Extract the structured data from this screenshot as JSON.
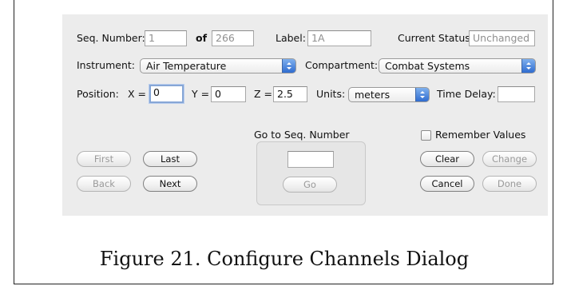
{
  "row1": {
    "seq_label": "Seq. Number:",
    "seq_value": "1",
    "of_label": "of",
    "total_value": "266",
    "label_label": "Label:",
    "label_value": "1A",
    "status_label": "Current Status:",
    "status_value": "Unchanged"
  },
  "row2": {
    "instrument_label": "Instrument:",
    "instrument_value": "Air Temperature",
    "compartment_label": "Compartment:",
    "compartment_value": "Combat Systems"
  },
  "row3": {
    "position_label": "Position:",
    "x_label": "X =",
    "x_value": "0",
    "y_label": "Y =",
    "y_value": "0",
    "z_label": "Z =",
    "z_value": "2.5",
    "units_label": "Units:",
    "units_value": "meters",
    "delay_label": "Time Delay:",
    "delay_value": ""
  },
  "goto": {
    "title": "Go to Seq. Number",
    "value": "",
    "go_label": "Go"
  },
  "remember": {
    "label": "Remember Values",
    "checked": false
  },
  "nav_buttons": {
    "first": "First",
    "last": "Last",
    "back": "Back",
    "next": "Next"
  },
  "action_buttons": {
    "clear": "Clear",
    "change": "Change",
    "cancel": "Cancel",
    "done": "Done"
  },
  "caption": "Figure 21.  Configure Channels Dialog",
  "colors": {
    "panel_bg": "#ececec",
    "focus_ring": "#86a6d6",
    "popup_arrow": "#2f6cd0"
  }
}
